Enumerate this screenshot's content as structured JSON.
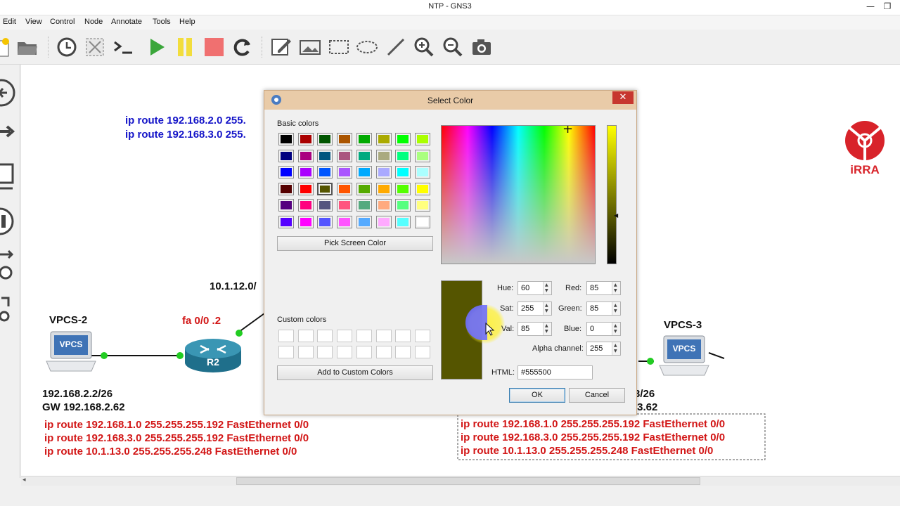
{
  "window": {
    "title": "NTP - GNS3",
    "minimize": "—",
    "restore": "❐"
  },
  "menu": [
    "Edit",
    "View",
    "Control",
    "Node",
    "Annotate",
    "Tools",
    "Help"
  ],
  "canvas": {
    "top_routes": [
      "ip route 192.168.2.0 255.",
      "ip route 192.168.3.0 255."
    ],
    "link_label": "10.1.12.0/",
    "iface_label": "fa 0/0 .2",
    "vpcs2": {
      "name": "VPCS-2",
      "icon_text": "VPCS",
      "ip": "192.168.2.2/26",
      "gw": "GW 192.168.2.62"
    },
    "router": {
      "name": "R2"
    },
    "vpcs3": {
      "name": "VPCS-3",
      "icon_text": "VPCS",
      "ip_partial": "3/26",
      "gw_partial": ".3.62"
    },
    "left_routes": [
      "ip route 192.168.1.0 255.255.255.192 FastEthernet 0/0",
      "ip route 192.168.3.0 255.255.255.192 FastEthernet 0/0",
      "ip route 10.1.13.0 255.255.255.248 FastEthernet 0/0"
    ],
    "right_routes": [
      "ip route 192.168.1.0 255.255.255.192 FastEthernet 0/0",
      "ip route 192.168.3.0 255.255.255.192 FastEthernet 0/0",
      "ip route 10.1.13.0 255.255.255.248 FastEthernet 0/0"
    ],
    "logo_text": "iRRA"
  },
  "dialog": {
    "title": "Select Color",
    "close": "✕",
    "basic_colors_label": "Basic colors",
    "custom_colors_label": "Custom colors",
    "pick_screen_color": "Pick Screen Color",
    "add_custom": "Add to Custom Colors",
    "ok": "OK",
    "cancel": "Cancel",
    "fields": {
      "hue_label": "Hue:",
      "hue": "60",
      "sat_label": "Sat:",
      "sat": "255",
      "val_label": "Val:",
      "val": "85",
      "red_label": "Red:",
      "red": "85",
      "green_label": "Green:",
      "green": "85",
      "blue_label": "Blue:",
      "blue": "0",
      "alpha_label": "Alpha channel:",
      "alpha": "255",
      "html_label": "HTML:",
      "html": "#555500"
    },
    "selected_color": "#555500",
    "basic_colors": [
      [
        "#000000",
        "#aa0000",
        "#005500",
        "#aa5500",
        "#00aa00",
        "#aaaa00",
        "#00ff00",
        "#aaff00"
      ],
      [
        "#00007f",
        "#aa007f",
        "#00557f",
        "#aa557f",
        "#00aa7f",
        "#aaaa7f",
        "#00ff7f",
        "#aaff7f"
      ],
      [
        "#0000ff",
        "#aa00ff",
        "#0055ff",
        "#aa55ff",
        "#00aaff",
        "#aaaaff",
        "#00ffff",
        "#aaffff"
      ],
      [
        "#550000",
        "#ff0000",
        "#555500",
        "#ff5500",
        "#55aa00",
        "#ffaa00",
        "#55ff00",
        "#ffff00"
      ],
      [
        "#55007f",
        "#ff007f",
        "#55557f",
        "#ff557f",
        "#55aa7f",
        "#ffaa7f",
        "#55ff7f",
        "#ffff7f"
      ],
      [
        "#5500ff",
        "#ff00ff",
        "#5555ff",
        "#ff55ff",
        "#55aaff",
        "#ffaaff",
        "#55ffff",
        "#ffffff"
      ]
    ]
  },
  "colors": {
    "route_blue": "#1414c8",
    "route_red": "#d21616",
    "link_green": "#22cc22"
  },
  "toolbar_icons": [
    "new-icon",
    "open-icon",
    "clock-icon",
    "snapshot-icon",
    "console-icon",
    "start-icon",
    "pause-icon",
    "stop-icon",
    "reload-icon",
    "note-icon",
    "image-icon",
    "rectangle-icon",
    "ellipse-icon",
    "line-icon",
    "zoom-in-icon",
    "zoom-out-icon",
    "screenshot-icon"
  ]
}
